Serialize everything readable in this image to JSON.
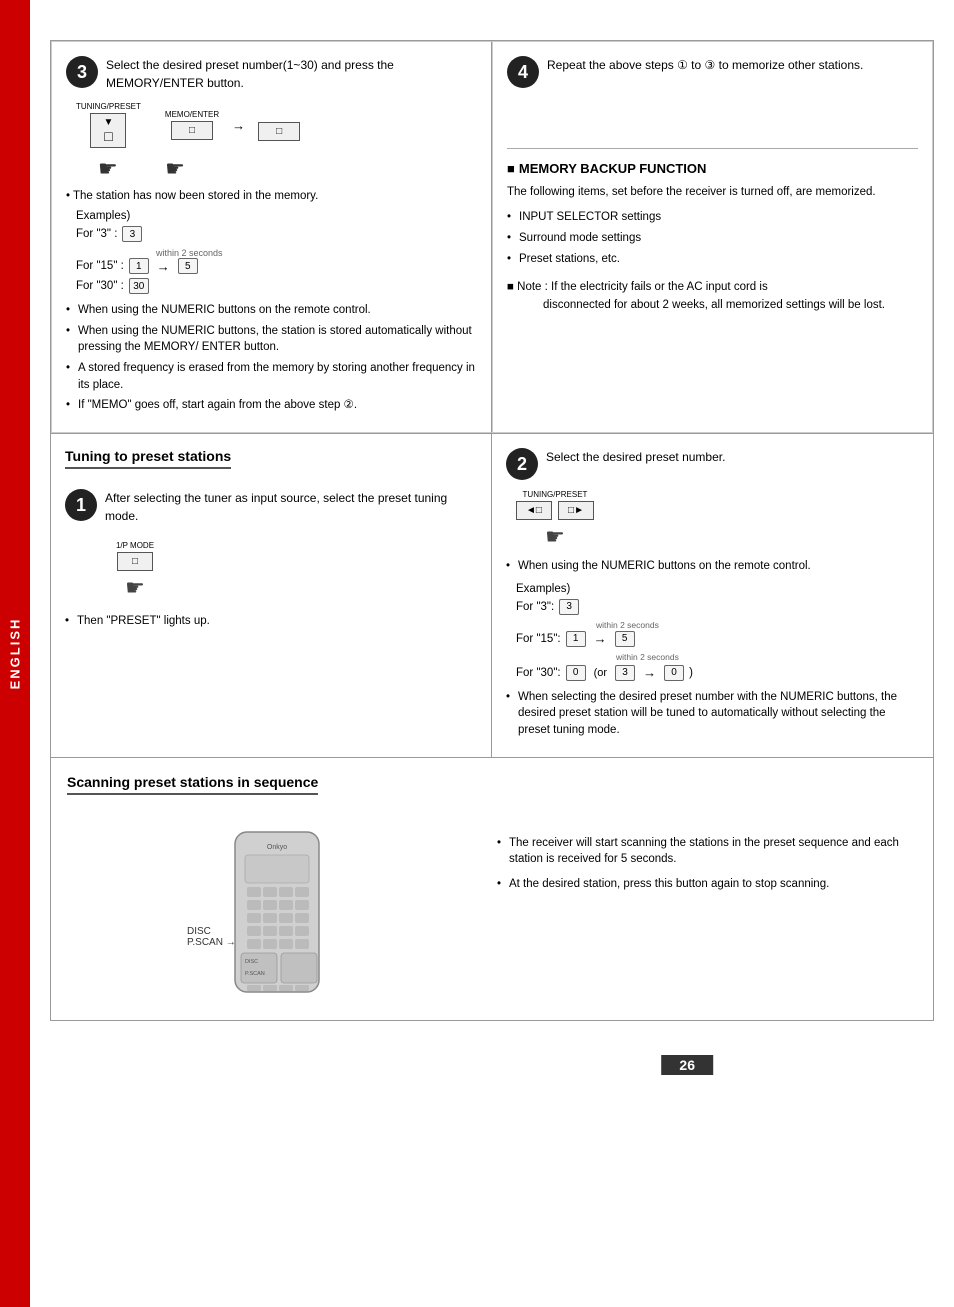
{
  "sidebar": {
    "label": "ENGLISH"
  },
  "page": {
    "number": "26"
  },
  "step3": {
    "circle": "3",
    "description": "Select the desired preset number(1~30) and press the MEMORY/ENTER button.",
    "tuning_preset_label": "TUNING/PRESET",
    "memo_enter_label": "MEMO/ENTER",
    "hand": "☛",
    "bullets": [
      "When using the NUMERIC buttons on the remote control.",
      "When using the NUMERIC buttons, the station is stored automatically without pressing the MEMORY/ ENTER button.",
      "A stored frequency is erased from the memory by storing another frequency in its place.",
      "If \"MEMO\" goes off, start again from the above step ②."
    ],
    "examples_label": "Examples)",
    "for3_label": "For \"3\" :",
    "for15_label": "For \"15\" :",
    "for30_label": "For \"30\" :",
    "within2": "within 2 seconds",
    "station_stored": "• The station has now been stored in the memory."
  },
  "step4": {
    "circle": "4",
    "description": "Repeat the above steps ① to ③ to memorize other stations."
  },
  "memory_backup": {
    "title": "MEMORY BACKUP FUNCTION",
    "intro": "The following items, set before the receiver is turned off, are memorized.",
    "items": [
      "INPUT SELECTOR settings",
      "Surround mode settings",
      "Preset stations, etc."
    ],
    "note": "■ Note : If the electricity fails or the AC input cord is disconnected for about 2 weeks, all memorized settings will be lost."
  },
  "tuning_section": {
    "heading": "Tuning to preset stations",
    "step1": {
      "circle": "1",
      "description": "After selecting the tuner as input source, select the preset tuning mode.",
      "mode_label": "1/P MODE",
      "hand": "☛",
      "bullet": "Then \"PRESET\" lights up."
    },
    "step2": {
      "circle": "2",
      "description": "Select the desired preset number.",
      "tuning_preset_label": "TUNING/PRESET",
      "hand": "☛",
      "examples_label": "Examples)",
      "for3_label": "For \"3\":",
      "for15_label": "For \"15\":",
      "for30_label": "For \"30\":",
      "within2": "within 2 seconds",
      "or_label": "(or",
      "bullet": "When selecting the desired preset number with the NUMERIC buttons, the desired preset station will be tuned to automatically without selecting the preset tuning mode.",
      "bullet2": "When using the NUMERIC buttons on the remote control."
    }
  },
  "scanning_section": {
    "heading": "Scanning preset stations in sequence",
    "bullets": [
      "The receiver will start scanning the stations in the preset sequence and each station is received for 5 seconds.",
      "At the desired  station, press this button again to stop scanning."
    ],
    "remote_brand": "Onkyo",
    "disc_scan_label": "DISC\nP.SCAN"
  }
}
